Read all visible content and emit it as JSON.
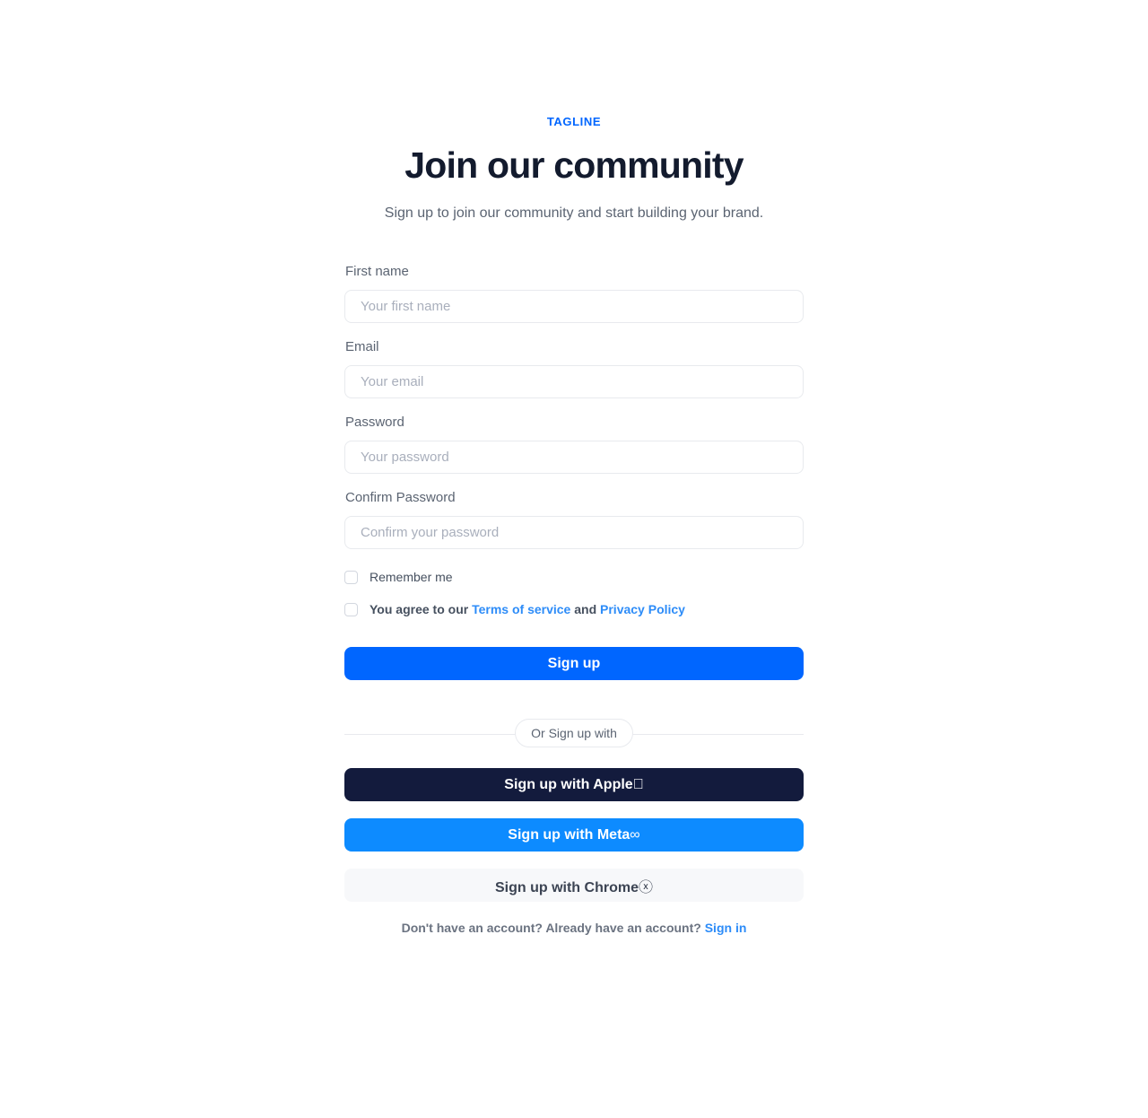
{
  "header": {
    "tagline": "TAGLINE",
    "title": "Join our community",
    "subtitle": "Sign up to join our community and start building your brand."
  },
  "form": {
    "fields": [
      {
        "label": "First name",
        "placeholder": "Your first name",
        "type": "text"
      },
      {
        "label": "Email",
        "placeholder": "Your email",
        "type": "text"
      },
      {
        "label": "Password",
        "placeholder": "Your password",
        "type": "password"
      },
      {
        "label": "Confirm Password",
        "placeholder": "Confirm your password",
        "type": "password"
      }
    ],
    "remember_label": "Remember me",
    "terms_prefix": "You agree to our ",
    "terms_link": "Terms of service",
    "terms_and": " and ",
    "privacy_link": "Privacy Policy",
    "submit_label": "Sign up"
  },
  "divider": {
    "label": "Or Sign up with"
  },
  "social": {
    "apple": {
      "label": "Sign up with Apple",
      "icon": "apple-icon",
      "glyph": "",
      "bg": "#131B3D"
    },
    "meta": {
      "label": "Sign up with Meta",
      "icon": "meta-icon",
      "glyph": "∞",
      "bg": "#0D8BFF"
    },
    "chrome": {
      "label": "Sign up with Chrome",
      "icon": "chrome-icon",
      "glyph": "ⓧ",
      "bg": "#F7F8FA"
    }
  },
  "footer": {
    "text": "Don't have an account? Already have an account? ",
    "link": "Sign in"
  },
  "colors": {
    "accent": "#0066FF",
    "link": "#2D8CF8",
    "heading": "#131B2E",
    "body_text": "#5B6472",
    "border": "#E8EAEE"
  }
}
